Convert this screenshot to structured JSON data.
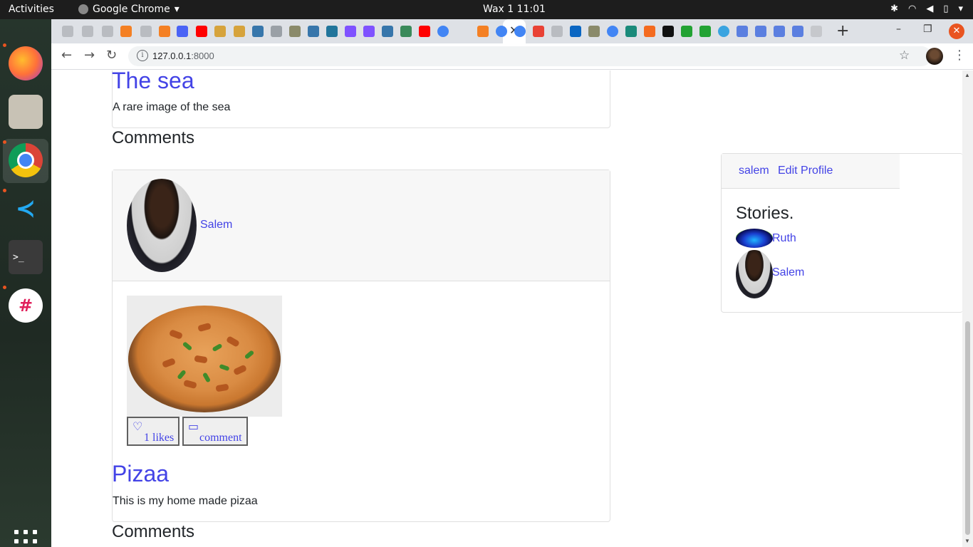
{
  "system": {
    "activities": "Activities",
    "app_name": "Google Chrome",
    "clock": "Wax 1  11:01"
  },
  "browser": {
    "url_host": "127.0.0.1",
    "url_port": ":8000",
    "close_tab_glyph": "✕",
    "new_tab_glyph": "+"
  },
  "page": {
    "post1": {
      "title": "The sea",
      "body": "A rare image of the sea"
    },
    "comments_heading_1": "Comments",
    "post2": {
      "author": "Salem",
      "likes_label": "1 likes",
      "comment_label": "comment",
      "title": "Pizaa",
      "body": "This is my home made pizaa"
    },
    "comments_heading_2": "Comments"
  },
  "sidebar": {
    "username": "salem",
    "edit_profile": "Edit Profile",
    "stories_title": "Stories.",
    "stories": [
      {
        "name": "Ruth"
      },
      {
        "name": "Salem"
      }
    ]
  },
  "colors": {
    "link": "#4343e6",
    "topbar": "#1d1d1d",
    "close_button": "#e95420"
  },
  "icons": {
    "like": "heart-icon",
    "comment": "speech-bubble-icon"
  }
}
